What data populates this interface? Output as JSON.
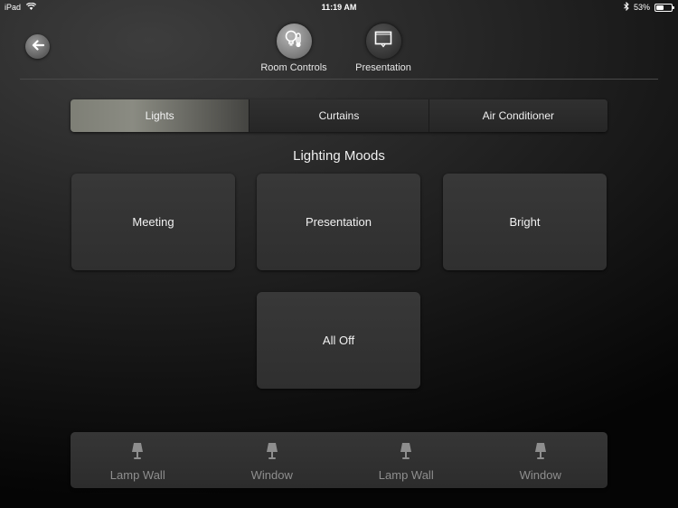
{
  "status_bar": {
    "device": "iPad",
    "time": "11:19 AM",
    "battery_text": "53%",
    "battery_level": 0.53
  },
  "header": {
    "back_icon": "arrow-left-icon",
    "nav": [
      {
        "label": "Room Controls",
        "icon": "lightbulb-thermometer-icon",
        "active": true
      },
      {
        "label": "Presentation",
        "icon": "projector-screen-icon",
        "active": false
      }
    ]
  },
  "tabs": [
    {
      "label": "Lights",
      "selected": true
    },
    {
      "label": "Curtains",
      "selected": false
    },
    {
      "label": "Air Conditioner",
      "selected": false
    }
  ],
  "section_title": "Lighting Moods",
  "moods": [
    {
      "label": "Meeting"
    },
    {
      "label": "Presentation"
    },
    {
      "label": "Bright"
    },
    {
      "label": "All Off"
    }
  ],
  "lamps": [
    {
      "label": "Lamp Wall",
      "icon": "lamp-icon"
    },
    {
      "label": "Window",
      "icon": "lamp-icon"
    },
    {
      "label": "Lamp Wall",
      "icon": "lamp-icon"
    },
    {
      "label": "Window",
      "icon": "lamp-icon"
    }
  ],
  "colors": {
    "selected_tab": "#85867d",
    "lamp_label": "#8e8e8e",
    "background": "#1a1a1a"
  }
}
